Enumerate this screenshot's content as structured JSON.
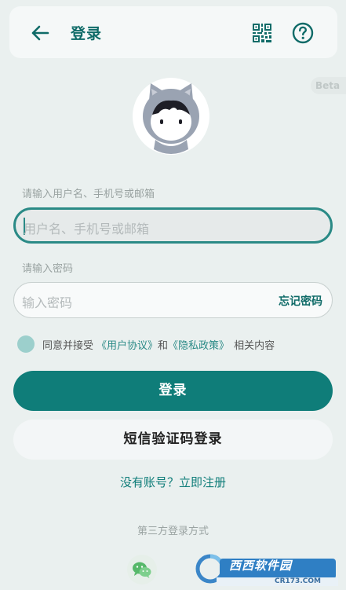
{
  "header": {
    "back_icon": "arrow-left-icon",
    "title": "登录",
    "qr_icon": "qr-code-icon",
    "help_icon": "help-circle-icon"
  },
  "beta_label": "Beta",
  "username": {
    "label": "请输入用户名、手机号或邮箱",
    "placeholder": "用户名、手机号或邮箱"
  },
  "password": {
    "label": "请输入密码",
    "placeholder": "输入密码",
    "forgot": "忘记密码"
  },
  "agreement": {
    "prefix": "同意并接受",
    "user_agreement": "《用户协议》",
    "and": "和",
    "privacy_policy": "《隐私政策》",
    "suffix": "相关内容"
  },
  "buttons": {
    "login": "登录",
    "sms_login": "短信验证码登录"
  },
  "register_link": "没有账号？立即注册",
  "third_party_label": "第三方登录方式",
  "third_party_icons": [
    "wechat-icon"
  ],
  "watermark": {
    "brand": "西西软件园",
    "url": "CR173.COM"
  },
  "colors": {
    "primary": "#0f7d79",
    "accent": "#2a8a86",
    "background": "#eaf0ef"
  }
}
